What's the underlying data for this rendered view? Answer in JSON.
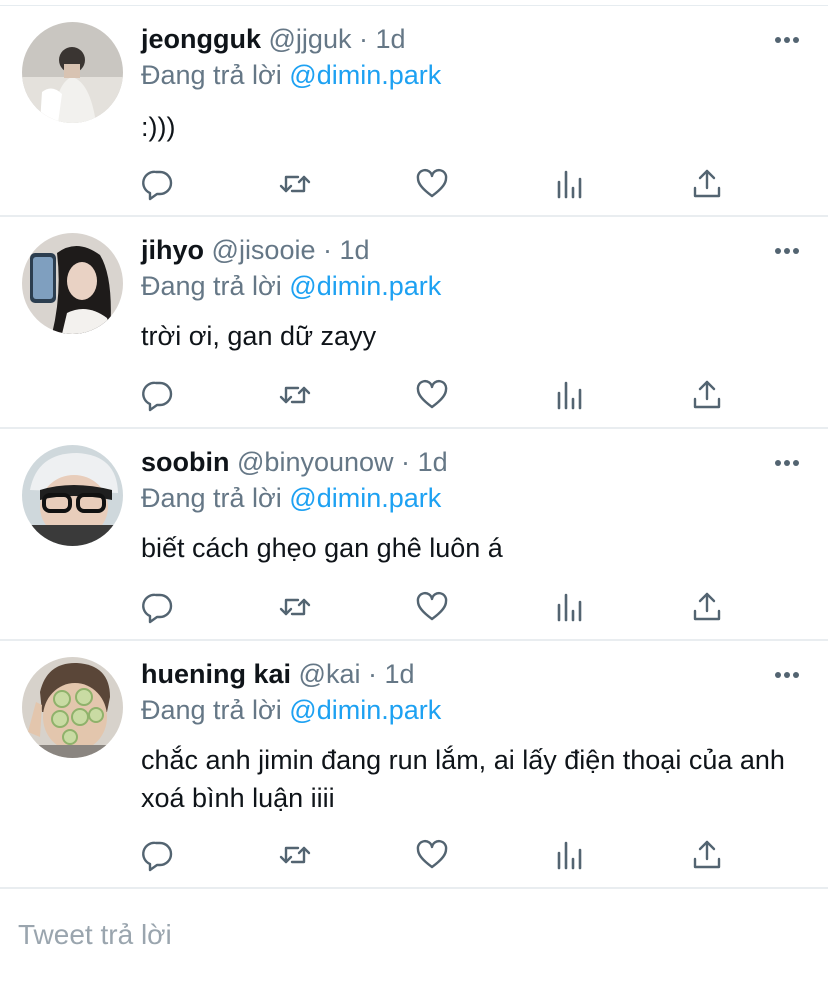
{
  "tweets": [
    {
      "name": "jeongguk",
      "handle": "@jjguk",
      "separator": "·",
      "time": "1d",
      "reply_prefix": "Đang trả lời",
      "reply_to": "@dimin.park",
      "text": ":)))"
    },
    {
      "name": "jihyo",
      "handle": "@jisooie",
      "separator": "·",
      "time": "1d",
      "reply_prefix": "Đang trả lời",
      "reply_to": "@dimin.park",
      "text": "trời ơi, gan dữ zayy"
    },
    {
      "name": "soobin",
      "handle": "@binyounow",
      "separator": "·",
      "time": "1d",
      "reply_prefix": "Đang trả lời",
      "reply_to": "@dimin.park",
      "text": "biết cách ghẹo gan ghê luôn á"
    },
    {
      "name": "huening kai",
      "handle": "@kai",
      "separator": "·",
      "time": "1d",
      "reply_prefix": "Đang trả lời",
      "reply_to": "@dimin.park",
      "text": "chắc anh jimin đang run lắm, ai lấy điện thoại của anh xoá bình luận iiii"
    }
  ],
  "actions": [
    "reply-icon",
    "retweet-icon",
    "like-icon",
    "analytics-icon",
    "share-icon"
  ],
  "compose": {
    "placeholder": "Tweet trả lời"
  },
  "colors": {
    "mention": "#1da1f2",
    "secondary_text": "#657786",
    "icon": "#536471",
    "divider": "#e9edf0"
  }
}
